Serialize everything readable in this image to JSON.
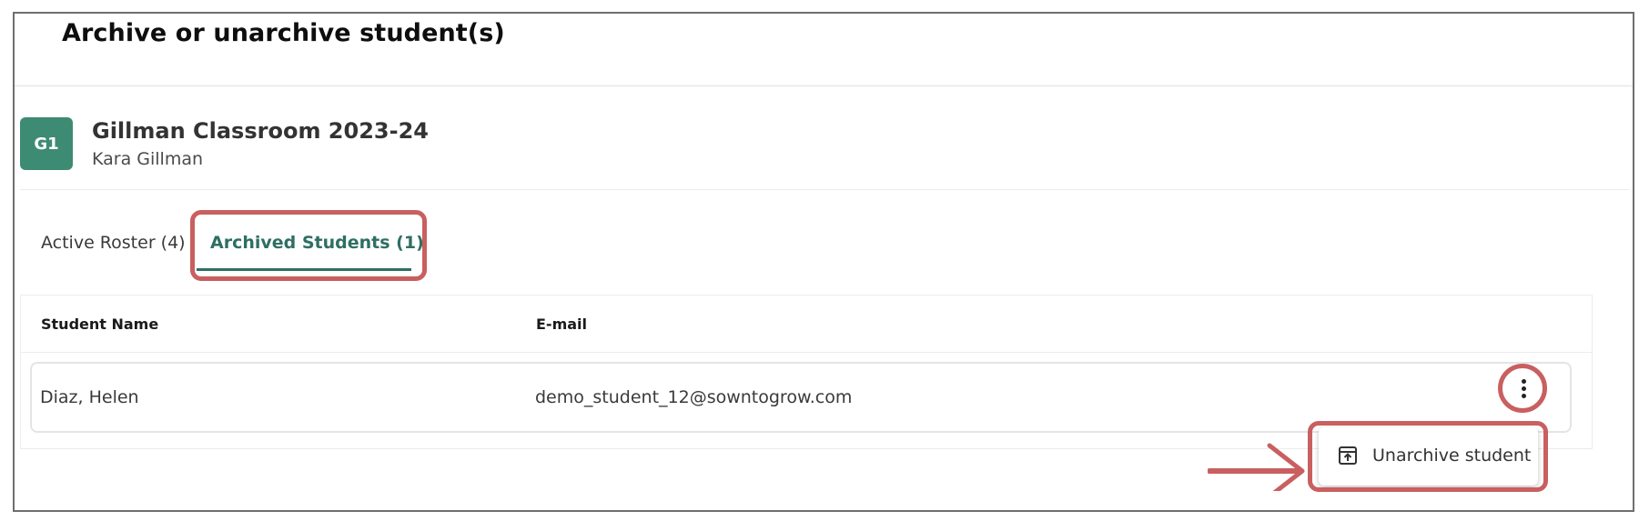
{
  "page": {
    "title": "Archive or unarchive student(s)"
  },
  "classroom": {
    "badge": "G1",
    "name": "Gillman Classroom 2023-24",
    "teacher": "Kara Gillman",
    "badge_color": "#3d8b73"
  },
  "tabs": [
    {
      "label": "Active Roster (4)",
      "active": false
    },
    {
      "label": "Archived Students (1)",
      "active": true
    }
  ],
  "table": {
    "headers": {
      "name": "Student Name",
      "email": "E-mail"
    },
    "rows": [
      {
        "name": "Diaz, Helen",
        "email": "demo_student_12@sowntogrow.com"
      }
    ]
  },
  "row_menu": {
    "icon": "more-vertical-icon",
    "items": [
      {
        "icon": "unarchive-box-icon",
        "label": "Unarchive student"
      }
    ]
  },
  "colors": {
    "accent": "#2f6f63",
    "annotation": "#c95f60"
  }
}
